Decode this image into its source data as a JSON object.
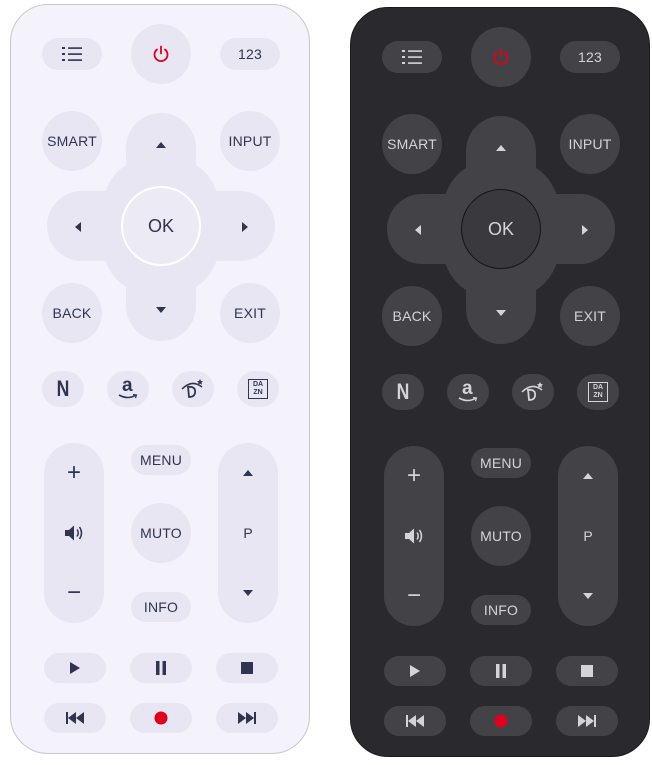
{
  "remotes": [
    {
      "theme": "light",
      "top_row": {
        "list_icon": "list-icon",
        "power_icon": "power-icon",
        "numbers_label": "123"
      },
      "dpad": {
        "smart_label": "SMART",
        "input_label": "INPUT",
        "ok_label": "OK",
        "back_label": "BACK",
        "exit_label": "EXIT"
      },
      "apps": [
        {
          "name": "netflix",
          "label": "N"
        },
        {
          "name": "amazon",
          "label": "a"
        },
        {
          "name": "disney",
          "label": ""
        },
        {
          "name": "dazn",
          "label_top": "DA",
          "label_bottom": "ZN"
        }
      ],
      "center": {
        "menu_label": "MENU",
        "mute_label": "MUTO",
        "info_label": "INFO"
      },
      "volume": {
        "plus": "+",
        "minus": "−"
      },
      "channel": {
        "label": "P"
      }
    },
    {
      "theme": "dark",
      "top_row": {
        "list_icon": "list-icon",
        "power_icon": "power-icon",
        "numbers_label": "123"
      },
      "dpad": {
        "smart_label": "SMART",
        "input_label": "INPUT",
        "ok_label": "OK",
        "back_label": "BACK",
        "exit_label": "EXIT"
      },
      "apps": [
        {
          "name": "netflix",
          "label": "N"
        },
        {
          "name": "amazon",
          "label": "a"
        },
        {
          "name": "disney",
          "label": ""
        },
        {
          "name": "dazn",
          "label_top": "DA",
          "label_bottom": "ZN"
        }
      ],
      "center": {
        "menu_label": "MENU",
        "mute_label": "MUTO",
        "info_label": "INFO"
      },
      "volume": {
        "plus": "+",
        "minus": "−"
      },
      "channel": {
        "label": "P"
      }
    }
  ],
  "colors": {
    "accent_red": "#e0001b",
    "light_bg": "#f4f2fb",
    "dark_bg": "#2a2a2e"
  }
}
